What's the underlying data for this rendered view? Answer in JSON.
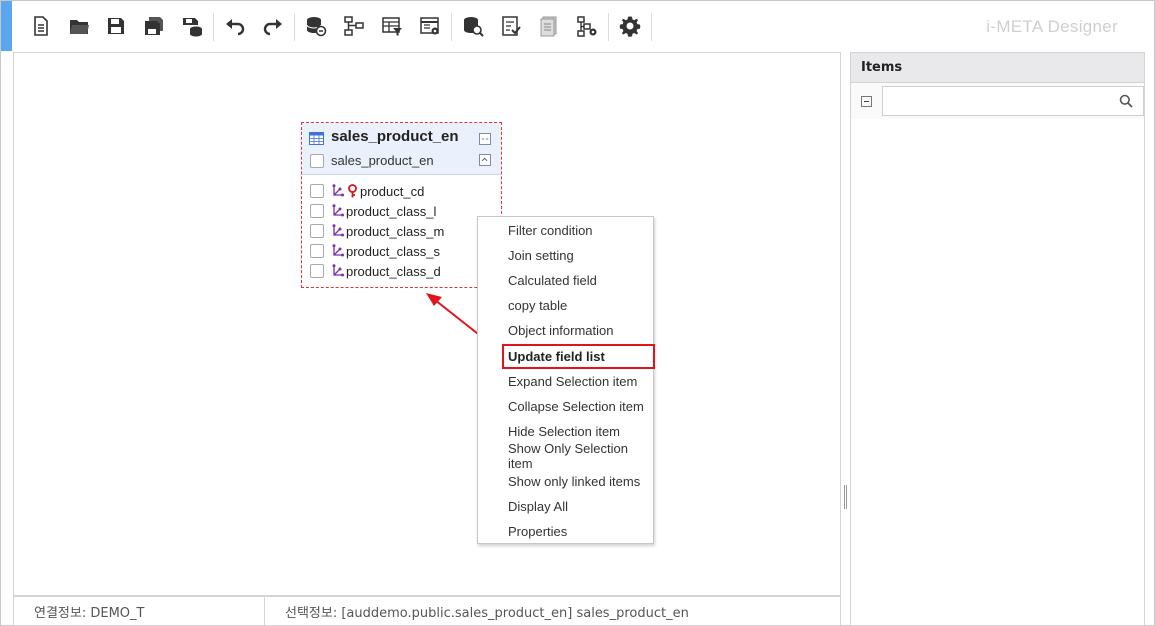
{
  "app": {
    "title": "i-META Designer",
    "accent_color": "#5aa7f0"
  },
  "toolbar": {
    "buttons": [
      {
        "icon": "new-document-icon"
      },
      {
        "icon": "open-folder-icon"
      },
      {
        "icon": "save-icon"
      },
      {
        "icon": "save-as-icon"
      },
      {
        "icon": "save-to-db-icon"
      },
      {
        "icon": "undo-icon"
      },
      {
        "icon": "redo-icon"
      },
      {
        "icon": "db-connect-icon"
      },
      {
        "icon": "hierarchy-icon"
      },
      {
        "icon": "table-filter-icon"
      },
      {
        "icon": "window-settings-icon"
      },
      {
        "icon": "db-search-icon"
      },
      {
        "icon": "checklist-icon"
      },
      {
        "icon": "document-icon"
      },
      {
        "icon": "tree-settings-icon"
      },
      {
        "icon": "gear-icon"
      }
    ]
  },
  "table": {
    "name": "sales_product_en",
    "alias": "sales_product_en",
    "fields": [
      {
        "name": "product_cd",
        "primary_key": true
      },
      {
        "name": "product_class_l",
        "primary_key": false
      },
      {
        "name": "product_class_m",
        "primary_key": false
      },
      {
        "name": "product_class_s",
        "primary_key": false
      },
      {
        "name": "product_class_d",
        "primary_key": false
      }
    ]
  },
  "context_menu": {
    "items": [
      "Filter condition",
      "Join setting",
      "Calculated field",
      "copy table",
      "Object information",
      "Update field list",
      "Expand Selection item",
      "Collapse Selection item",
      "Hide Selection item",
      "Show Only Selection item",
      "Show only linked items",
      "Display All",
      "Properties"
    ],
    "highlighted": "Update field list",
    "highlight_color": "#e0141c"
  },
  "items_panel": {
    "title": "Items",
    "search_value": "",
    "search_placeholder": ""
  },
  "status": {
    "connection": "연결정보: DEMO_T",
    "selection": "선택정보: [auddemo.public.sales_product_en] sales_product_en"
  }
}
